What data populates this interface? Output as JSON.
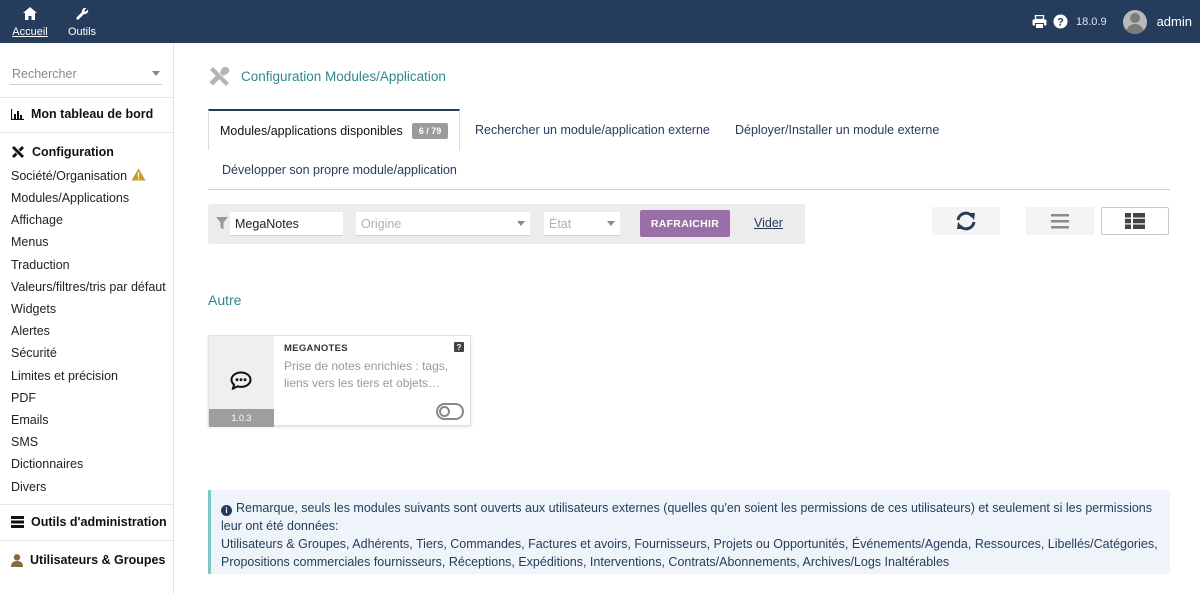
{
  "topbar": {
    "nav": [
      {
        "label": "Accueil",
        "icon": "home-icon"
      },
      {
        "label": "Outils",
        "icon": "wrench-icon"
      }
    ],
    "version": "18.0.9",
    "user": "admin"
  },
  "sidebar": {
    "search_placeholder": "Rechercher",
    "dashboard": "Mon tableau de bord",
    "config_header": "Configuration",
    "config_items": [
      "Société/Organisation",
      "Modules/Applications",
      "Affichage",
      "Menus",
      "Traduction",
      "Valeurs/filtres/tris par défaut",
      "Widgets",
      "Alertes",
      "Sécurité",
      "Limites et précision",
      "PDF",
      "Emails",
      "SMS",
      "Dictionnaires",
      "Divers"
    ],
    "admin_tools": "Outils d'administration",
    "users_groups": "Utilisateurs & Groupes"
  },
  "main": {
    "title": "Configuration Modules/Application",
    "tabs": [
      {
        "label": "Modules/applications disponibles",
        "badge": "6 / 79"
      },
      {
        "label": "Rechercher un module/application externe"
      },
      {
        "label": "Déployer/Installer un module externe"
      },
      {
        "label": "Développer son propre module/application"
      }
    ],
    "filter": {
      "search_value": "MegaNotes",
      "origin_placeholder": "Origine",
      "state_placeholder": "État",
      "refresh_label": "RAFRAICHIR",
      "clear_label": "Vider"
    },
    "section_title": "Autre",
    "module_card": {
      "name": "MEGANOTES",
      "description": "Prise de notes enrichies : tags, liens vers les tiers et objets…",
      "version": "1.0.3",
      "help": "?",
      "icon": "comment-dots-icon",
      "enabled": false
    },
    "note": {
      "line1": "Remarque, seuls les modules suivants sont ouverts aux utilisateurs externes (quelles qu'en soient les permissions de ces utilisateurs) et seulement si les permissions leur ont été données:",
      "line2": "Utilisateurs & Groupes, Adhérents, Tiers, Commandes, Factures et avoirs, Fournisseurs, Projets ou Opportunités, Événements/Agenda, Ressources, Libellés/Catégories, Propositions commerciales fournisseurs, Réceptions, Expéditions, Interventions, Contrats/Abonnements, Archives/Logs Inaltérables"
    }
  },
  "colors": {
    "topbar": "#263c5c",
    "accent_teal": "#2c8a88",
    "refresh_button": "#9a6fa8",
    "warning": "#c99a1e"
  }
}
